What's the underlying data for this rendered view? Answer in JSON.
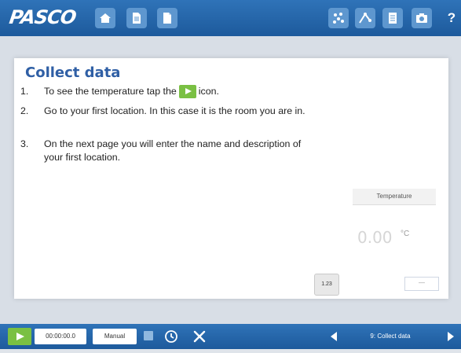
{
  "app": {
    "logo_text": "PASCO"
  },
  "toolbar": {
    "left_icons": [
      "home-icon",
      "document-icon",
      "document-icon"
    ],
    "right_icons": [
      "data-points-icon",
      "graph-tool-icon",
      "journal-icon",
      "camera-icon"
    ],
    "help_label": "?"
  },
  "content": {
    "title": "Collect data",
    "steps": [
      {
        "num": "1.",
        "text_before": "To see the temperature tap the",
        "text_after": "icon."
      },
      {
        "num": "2.",
        "text": "Go to your first location. In this case it is the room you are in."
      },
      {
        "num": "3.",
        "text": "On the next page you will enter the name and description of your first location."
      }
    ]
  },
  "display": {
    "label": "Temperature",
    "value": "0.00",
    "unit": "°C",
    "number_button": "1.23",
    "small_box": "—"
  },
  "bottombar": {
    "time": "00:00:00.0",
    "mode": "Manual",
    "page_label": "9: Collect data"
  },
  "colors": {
    "bar_blue": "#2f73b8",
    "title_blue": "#2f5fa5",
    "play_green": "#7ac043"
  }
}
